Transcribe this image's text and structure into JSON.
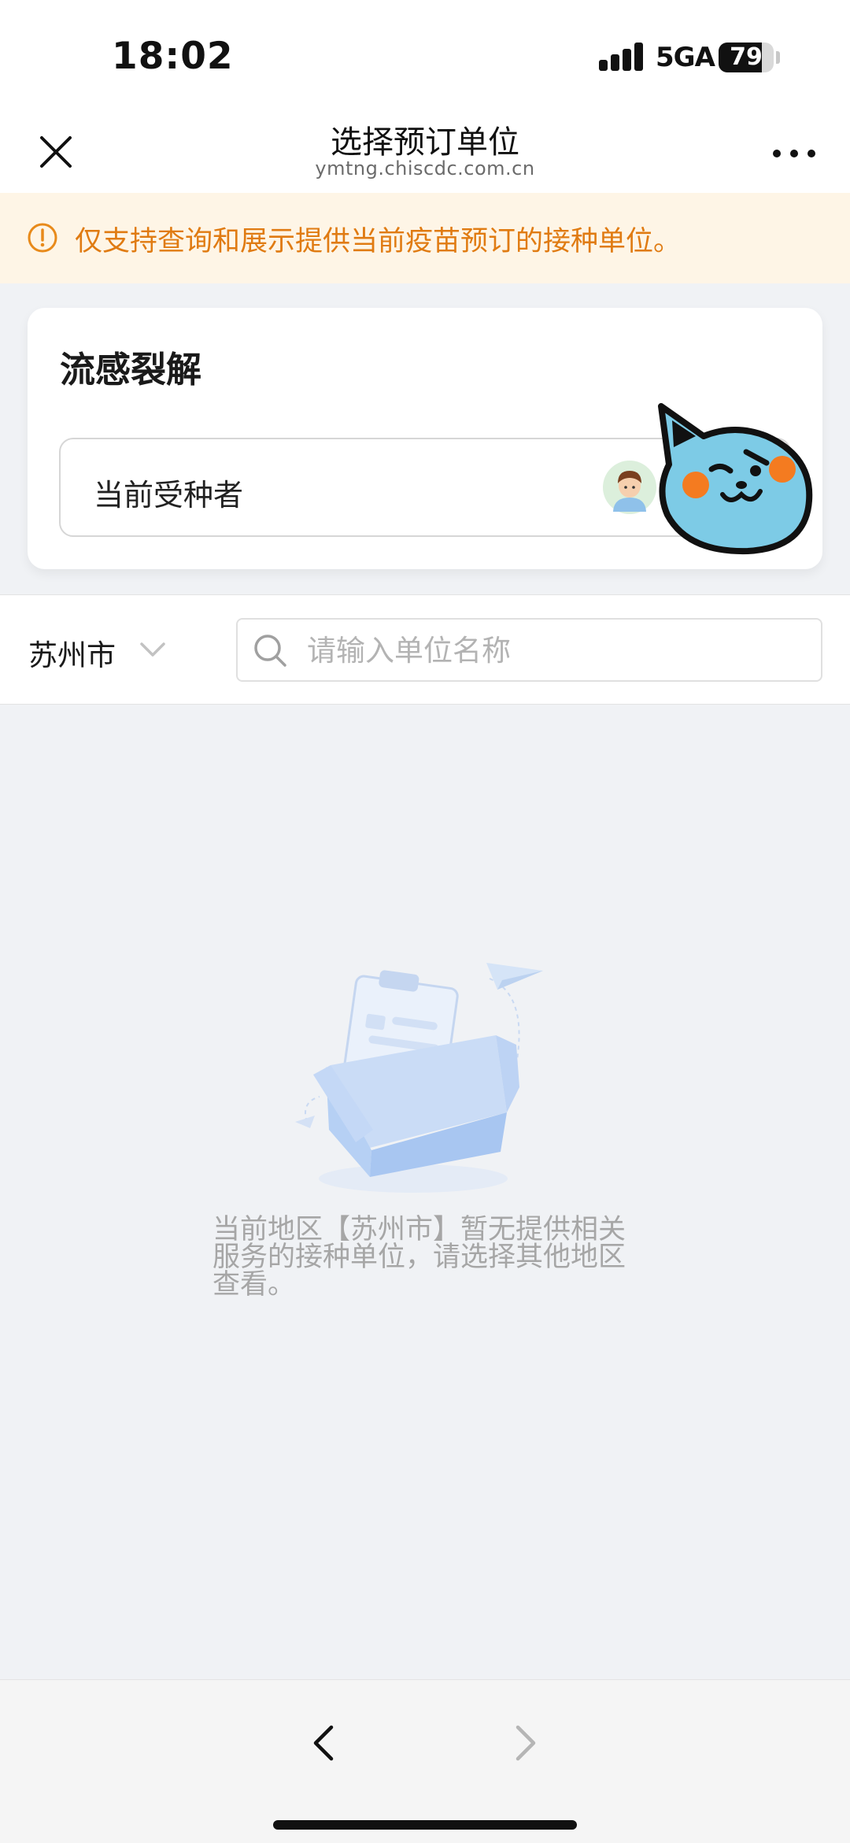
{
  "status_bar": {
    "time": "18:02",
    "network": "5GA",
    "battery_level": 79,
    "battery_text": "79"
  },
  "header": {
    "title": "选择预订单位",
    "url": "ymtng.chiscdc.com.cn",
    "close_icon": "close-icon",
    "more_icon": "more-icon"
  },
  "notice": {
    "icon": "warning-icon",
    "text": "仅支持查询和展示提供当前疫苗预订的接种单位。",
    "color": "#e07b12",
    "background": "#fef5e6"
  },
  "card": {
    "title": "流感裂解",
    "recipient_label": "当前受种者"
  },
  "filter": {
    "city": "苏州市",
    "search_placeholder": "请输入单位名称",
    "search_value": ""
  },
  "empty_state": {
    "message": "当前地区【苏州市】暂无提供相关服务的接种单位，请选择其他地区查看。"
  },
  "colors": {
    "page_background": "#f0f2f5",
    "accent_orange": "#e07b12",
    "mascot_blue": "#7dcbe6"
  }
}
